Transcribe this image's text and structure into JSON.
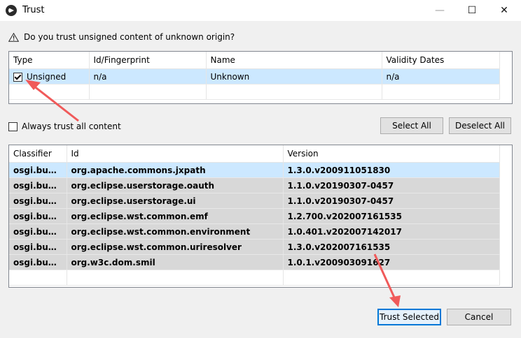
{
  "window": {
    "title": "Trust",
    "minimize_icon": "—",
    "maximize_icon": "☐",
    "close_icon": "✕"
  },
  "question": "Do you trust unsigned content of unknown origin?",
  "trust_table": {
    "headers": [
      "Type",
      "Id/Fingerprint",
      "Name",
      "Validity Dates"
    ],
    "rows": [
      {
        "type": "Unsigned",
        "checked": true,
        "id": "n/a",
        "name": "Unknown",
        "validity": "n/a"
      }
    ]
  },
  "always_trust_label": "Always trust all content",
  "select_all_label": "Select All",
  "deselect_all_label": "Deselect All",
  "content_table": {
    "headers": [
      "Classifier",
      "Id",
      "Version"
    ],
    "rows": [
      {
        "classifier": "osgi.bund...",
        "id": "org.apache.commons.jxpath",
        "version": "1.3.0.v200911051830"
      },
      {
        "classifier": "osgi.bund...",
        "id": "org.eclipse.userstorage.oauth",
        "version": "1.1.0.v20190307-0457"
      },
      {
        "classifier": "osgi.bund...",
        "id": "org.eclipse.userstorage.ui",
        "version": "1.1.0.v20190307-0457"
      },
      {
        "classifier": "osgi.bund...",
        "id": "org.eclipse.wst.common.emf",
        "version": "1.2.700.v202007161535"
      },
      {
        "classifier": "osgi.bund...",
        "id": "org.eclipse.wst.common.environment",
        "version": "1.0.401.v202007142017"
      },
      {
        "classifier": "osgi.bund...",
        "id": "org.eclipse.wst.common.uriresolver",
        "version": "1.3.0.v202007161535"
      },
      {
        "classifier": "osgi.bund...",
        "id": "org.w3c.dom.smil",
        "version": "1.0.1.v200903091627"
      }
    ]
  },
  "trust_selected_label": "Trust Selected",
  "cancel_label": "Cancel",
  "colors": {
    "selection": "#cce8ff",
    "row_gray": "#d8d8d8",
    "arrow": "#f05a5a",
    "primary_border": "#0078d7"
  }
}
